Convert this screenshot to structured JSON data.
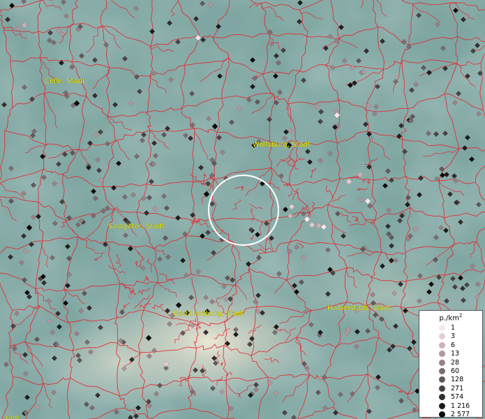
{
  "map": {
    "cities": [
      {
        "name": "Celle, Stadt"
      },
      {
        "name": "Wolfsburg, Stadt"
      },
      {
        "name": "Salzgitter, Stadt"
      },
      {
        "name": "Bad Harzburg, Stadt"
      },
      {
        "name": "Halberstadt, Stadt"
      },
      {
        "name": "…tadt"
      }
    ],
    "boundary_color": "#e8222a",
    "background_color": "#7fa6a2",
    "marker_shape": "diamond",
    "highlight": "selection-circle"
  },
  "legend": {
    "unit": "p./km",
    "unit_sup": "2",
    "entries": [
      {
        "label": "1",
        "color": "#f6e8ea"
      },
      {
        "label": "3",
        "color": "#e4cdd1"
      },
      {
        "label": "6",
        "color": "#cdb0b6"
      },
      {
        "label": "13",
        "color": "#b3979d"
      },
      {
        "label": "28",
        "color": "#998287"
      },
      {
        "label": "60",
        "color": "#7d6c70"
      },
      {
        "label": "128",
        "color": "#62575a"
      },
      {
        "label": "271",
        "color": "#4a4244"
      },
      {
        "label": "574",
        "color": "#332d2f"
      },
      {
        "label": "1 216",
        "color": "#1e1a1b"
      },
      {
        "label": "2 577",
        "color": "#0b0909"
      }
    ]
  }
}
